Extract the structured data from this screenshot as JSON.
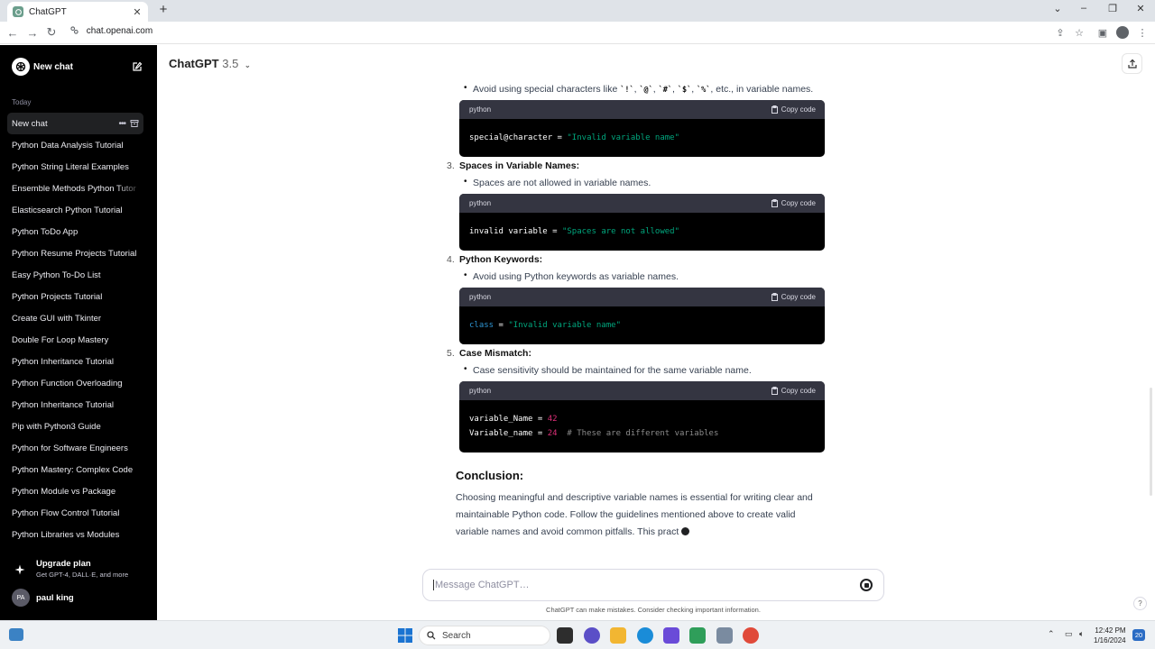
{
  "browser": {
    "tab_title": "ChatGPT",
    "url": "chat.openai.com"
  },
  "sidebar": {
    "new_chat_label": "New chat",
    "section_today": "Today",
    "items": [
      {
        "label": "New chat"
      },
      {
        "label": "Python Data Analysis Tutorial"
      },
      {
        "label": "Python String Literal Examples"
      },
      {
        "label": "Ensemble Methods Python Tutor"
      },
      {
        "label": "Elasticsearch Python Tutorial"
      },
      {
        "label": "Python ToDo App"
      },
      {
        "label": "Python Resume Projects Tutorial"
      },
      {
        "label": "Easy Python To-Do List"
      },
      {
        "label": "Python Projects Tutorial"
      },
      {
        "label": "Create GUI with Tkinter"
      },
      {
        "label": "Double For Loop Mastery"
      },
      {
        "label": "Python Inheritance Tutorial"
      },
      {
        "label": "Python Function Overloading"
      },
      {
        "label": "Python Inheritance Tutorial"
      },
      {
        "label": "Pip with Python3 Guide"
      },
      {
        "label": "Python for Software Engineers"
      },
      {
        "label": "Python Mastery: Complex Code"
      },
      {
        "label": "Python Module vs Package"
      },
      {
        "label": "Python Flow Control Tutorial"
      },
      {
        "label": "Python Libraries vs Modules"
      }
    ],
    "upgrade_title": "Upgrade plan",
    "upgrade_subtitle": "Get GPT-4, DALL·E, and more",
    "user_initials": "PA",
    "user_name": "paul king"
  },
  "header": {
    "model_name": "ChatGPT",
    "model_version": "3.5"
  },
  "message": {
    "bullet_special": {
      "prefix": "Avoid using special characters like ",
      "chars": [
        "`!`",
        "`@`",
        "`#`",
        "`$`",
        "`%`"
      ],
      "suffix": ", etc., in variable names."
    },
    "sections": [
      {
        "number": "3.",
        "title": "Spaces in Variable Names:",
        "bullet": "Spaces are not allowed in variable names."
      },
      {
        "number": "4.",
        "title": "Python Keywords:",
        "bullet": "Avoid using Python keywords as variable names."
      },
      {
        "number": "5.",
        "title": "Case Mismatch:",
        "bullet": "Case sensitivity should be maintained for the same variable name."
      }
    ],
    "code_lang": "python",
    "copy_label": "Copy code",
    "code1": {
      "var": "special@character",
      "op": " = ",
      "str": "\"Invalid variable name\""
    },
    "code2": {
      "var": "invalid variable",
      "op": " = ",
      "str": "\"Spaces are not allowed\""
    },
    "code3": {
      "kw": "class",
      "op": " = ",
      "str": "\"Invalid variable name\""
    },
    "code4": {
      "line1_var": "variable_Name",
      "line1_op": " = ",
      "line1_num": "42",
      "line2_var": "Variable_name",
      "line2_op": " = ",
      "line2_num": "24",
      "line2_comment": "# These are different variables"
    },
    "conclusion_title": "Conclusion:",
    "conclusion_text": "Choosing meaningful and descriptive variable names is essential for writing clear and maintainable Python code. Follow the guidelines mentioned above to create valid variable names and avoid common pitfalls. This pract"
  },
  "composer": {
    "placeholder": "Message ChatGPT…",
    "disclaimer": "ChatGPT can make mistakes. Consider checking important information.",
    "help": "?"
  },
  "taskbar": {
    "search_label": "Search",
    "time": "12:42 PM",
    "date": "1/16/2024",
    "notifications": "20"
  },
  "colors": {
    "sidebar_bg": "#000000",
    "code_header": "#343541",
    "string": "#00a67d",
    "keyword": "#2e95d3",
    "number": "#df3079"
  }
}
